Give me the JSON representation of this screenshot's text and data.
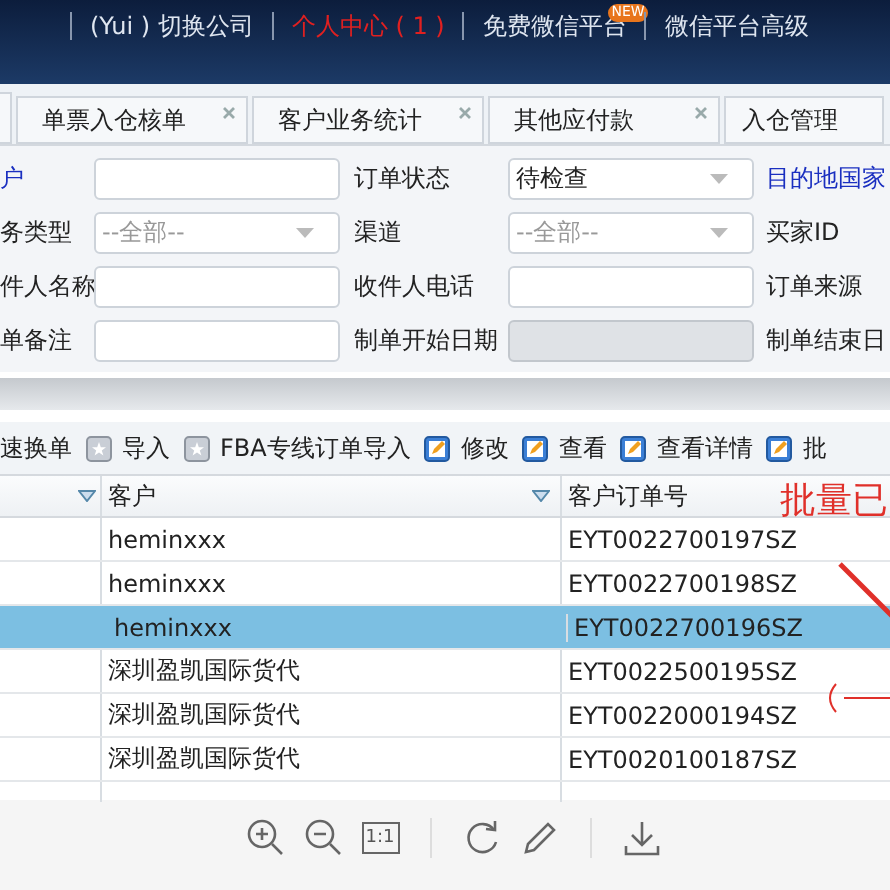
{
  "header": {
    "links": [
      {
        "label": "(Yui ) 切换公司",
        "highlight": false
      },
      {
        "label": "个人中心 ( 1 )",
        "highlight": true
      },
      {
        "label": "免费微信平台",
        "badge": "NEW",
        "highlight": false
      },
      {
        "label": "微信平台高级",
        "highlight": false
      }
    ]
  },
  "tabs": [
    {
      "label": "单票入仓核单",
      "kind": "closable"
    },
    {
      "label": "客户业务统计",
      "kind": "closable"
    },
    {
      "label": "其他应付款",
      "kind": "closable"
    },
    {
      "label": "入仓管理",
      "kind": "plain"
    }
  ],
  "form": {
    "rows": [
      [
        {
          "label": "户",
          "link": true,
          "kind": "input",
          "disabled": false
        },
        {
          "label": "订单状态",
          "link": false,
          "kind": "select",
          "value": "待检查"
        },
        {
          "label": "目的地国家",
          "link": true
        }
      ],
      [
        {
          "label": "务类型",
          "link": false,
          "kind": "select",
          "placeholder": "--全部--"
        },
        {
          "label": "渠道",
          "link": false,
          "kind": "select",
          "placeholder": "--全部--"
        },
        {
          "label": "买家ID",
          "link": false
        }
      ],
      [
        {
          "label": "件人名称",
          "link": false,
          "kind": "input",
          "disabled": false
        },
        {
          "label": "收件人电话",
          "link": false,
          "kind": "input",
          "disabled": false
        },
        {
          "label": "订单来源",
          "link": false
        }
      ],
      [
        {
          "label": "单备注",
          "link": false,
          "kind": "input",
          "disabled": false
        },
        {
          "label": "制单开始日期",
          "link": false,
          "kind": "input",
          "disabled": true
        },
        {
          "label": "制单结束日",
          "link": false
        }
      ]
    ]
  },
  "toolbar": [
    {
      "label": "速换单",
      "kind": "text"
    },
    {
      "label": "导入",
      "kind": "import"
    },
    {
      "label": "FBA专线订单导入",
      "kind": "import"
    },
    {
      "label": "修改",
      "kind": "edit"
    },
    {
      "label": "查看",
      "kind": "edit"
    },
    {
      "label": "查看详情",
      "kind": "edit"
    },
    {
      "label": "批",
      "kind": "edit"
    }
  ],
  "table": {
    "columns": [
      "客户",
      "客户订单号"
    ],
    "rows": [
      {
        "customer": "heminxxx",
        "order": "EYT0022700197SZ",
        "selected": false
      },
      {
        "customer": "heminxxx",
        "order": "EYT0022700198SZ",
        "selected": false
      },
      {
        "customer": "heminxxx",
        "order": "EYT0022700196SZ",
        "selected": true
      },
      {
        "customer": "深圳盈凯国际货代",
        "order": "EYT0022500195SZ",
        "selected": false
      },
      {
        "customer": "深圳盈凯国际货代",
        "order": "EYT0022000194SZ",
        "selected": false
      },
      {
        "customer": "深圳盈凯国际货代",
        "order": "EYT0020100187SZ",
        "selected": false
      }
    ]
  },
  "annotation": {
    "text": "批量已"
  },
  "viewer_toolbar": {
    "ratio_label": "1:1"
  }
}
